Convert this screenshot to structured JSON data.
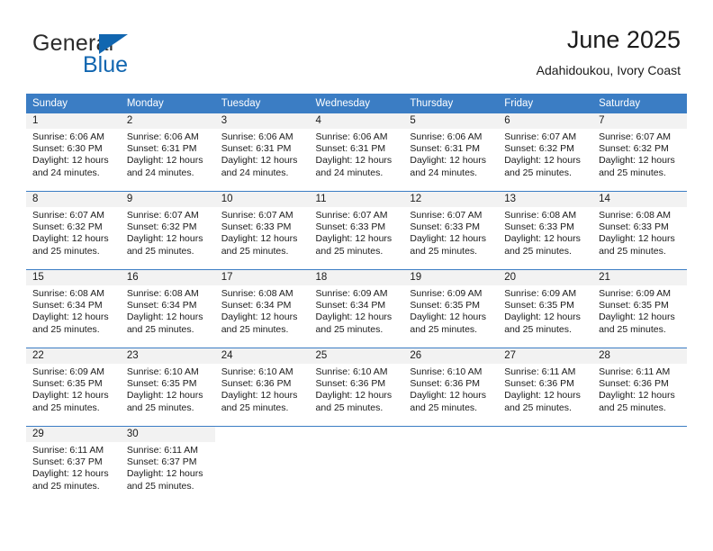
{
  "brand": {
    "line1": "General",
    "line2": "Blue",
    "accent_color": "#1166b0",
    "triangle_icon": "triangle-icon"
  },
  "header": {
    "title": "June 2025",
    "subtitle": "Adahidoukou, Ivory Coast"
  },
  "calendar": {
    "header_bg": "#3b7dc4",
    "header_text_color": "#ffffff",
    "daynum_bg": "#f2f2f2",
    "weekdays": [
      "Sunday",
      "Monday",
      "Tuesday",
      "Wednesday",
      "Thursday",
      "Friday",
      "Saturday"
    ],
    "weeks": [
      [
        {
          "day": "1",
          "sunrise": "Sunrise: 6:06 AM",
          "sunset": "Sunset: 6:30 PM",
          "daylight1": "Daylight: 12 hours",
          "daylight2": "and 24 minutes."
        },
        {
          "day": "2",
          "sunrise": "Sunrise: 6:06 AM",
          "sunset": "Sunset: 6:31 PM",
          "daylight1": "Daylight: 12 hours",
          "daylight2": "and 24 minutes."
        },
        {
          "day": "3",
          "sunrise": "Sunrise: 6:06 AM",
          "sunset": "Sunset: 6:31 PM",
          "daylight1": "Daylight: 12 hours",
          "daylight2": "and 24 minutes."
        },
        {
          "day": "4",
          "sunrise": "Sunrise: 6:06 AM",
          "sunset": "Sunset: 6:31 PM",
          "daylight1": "Daylight: 12 hours",
          "daylight2": "and 24 minutes."
        },
        {
          "day": "5",
          "sunrise": "Sunrise: 6:06 AM",
          "sunset": "Sunset: 6:31 PM",
          "daylight1": "Daylight: 12 hours",
          "daylight2": "and 24 minutes."
        },
        {
          "day": "6",
          "sunrise": "Sunrise: 6:07 AM",
          "sunset": "Sunset: 6:32 PM",
          "daylight1": "Daylight: 12 hours",
          "daylight2": "and 25 minutes."
        },
        {
          "day": "7",
          "sunrise": "Sunrise: 6:07 AM",
          "sunset": "Sunset: 6:32 PM",
          "daylight1": "Daylight: 12 hours",
          "daylight2": "and 25 minutes."
        }
      ],
      [
        {
          "day": "8",
          "sunrise": "Sunrise: 6:07 AM",
          "sunset": "Sunset: 6:32 PM",
          "daylight1": "Daylight: 12 hours",
          "daylight2": "and 25 minutes."
        },
        {
          "day": "9",
          "sunrise": "Sunrise: 6:07 AM",
          "sunset": "Sunset: 6:32 PM",
          "daylight1": "Daylight: 12 hours",
          "daylight2": "and 25 minutes."
        },
        {
          "day": "10",
          "sunrise": "Sunrise: 6:07 AM",
          "sunset": "Sunset: 6:33 PM",
          "daylight1": "Daylight: 12 hours",
          "daylight2": "and 25 minutes."
        },
        {
          "day": "11",
          "sunrise": "Sunrise: 6:07 AM",
          "sunset": "Sunset: 6:33 PM",
          "daylight1": "Daylight: 12 hours",
          "daylight2": "and 25 minutes."
        },
        {
          "day": "12",
          "sunrise": "Sunrise: 6:07 AM",
          "sunset": "Sunset: 6:33 PM",
          "daylight1": "Daylight: 12 hours",
          "daylight2": "and 25 minutes."
        },
        {
          "day": "13",
          "sunrise": "Sunrise: 6:08 AM",
          "sunset": "Sunset: 6:33 PM",
          "daylight1": "Daylight: 12 hours",
          "daylight2": "and 25 minutes."
        },
        {
          "day": "14",
          "sunrise": "Sunrise: 6:08 AM",
          "sunset": "Sunset: 6:33 PM",
          "daylight1": "Daylight: 12 hours",
          "daylight2": "and 25 minutes."
        }
      ],
      [
        {
          "day": "15",
          "sunrise": "Sunrise: 6:08 AM",
          "sunset": "Sunset: 6:34 PM",
          "daylight1": "Daylight: 12 hours",
          "daylight2": "and 25 minutes."
        },
        {
          "day": "16",
          "sunrise": "Sunrise: 6:08 AM",
          "sunset": "Sunset: 6:34 PM",
          "daylight1": "Daylight: 12 hours",
          "daylight2": "and 25 minutes."
        },
        {
          "day": "17",
          "sunrise": "Sunrise: 6:08 AM",
          "sunset": "Sunset: 6:34 PM",
          "daylight1": "Daylight: 12 hours",
          "daylight2": "and 25 minutes."
        },
        {
          "day": "18",
          "sunrise": "Sunrise: 6:09 AM",
          "sunset": "Sunset: 6:34 PM",
          "daylight1": "Daylight: 12 hours",
          "daylight2": "and 25 minutes."
        },
        {
          "day": "19",
          "sunrise": "Sunrise: 6:09 AM",
          "sunset": "Sunset: 6:35 PM",
          "daylight1": "Daylight: 12 hours",
          "daylight2": "and 25 minutes."
        },
        {
          "day": "20",
          "sunrise": "Sunrise: 6:09 AM",
          "sunset": "Sunset: 6:35 PM",
          "daylight1": "Daylight: 12 hours",
          "daylight2": "and 25 minutes."
        },
        {
          "day": "21",
          "sunrise": "Sunrise: 6:09 AM",
          "sunset": "Sunset: 6:35 PM",
          "daylight1": "Daylight: 12 hours",
          "daylight2": "and 25 minutes."
        }
      ],
      [
        {
          "day": "22",
          "sunrise": "Sunrise: 6:09 AM",
          "sunset": "Sunset: 6:35 PM",
          "daylight1": "Daylight: 12 hours",
          "daylight2": "and 25 minutes."
        },
        {
          "day": "23",
          "sunrise": "Sunrise: 6:10 AM",
          "sunset": "Sunset: 6:35 PM",
          "daylight1": "Daylight: 12 hours",
          "daylight2": "and 25 minutes."
        },
        {
          "day": "24",
          "sunrise": "Sunrise: 6:10 AM",
          "sunset": "Sunset: 6:36 PM",
          "daylight1": "Daylight: 12 hours",
          "daylight2": "and 25 minutes."
        },
        {
          "day": "25",
          "sunrise": "Sunrise: 6:10 AM",
          "sunset": "Sunset: 6:36 PM",
          "daylight1": "Daylight: 12 hours",
          "daylight2": "and 25 minutes."
        },
        {
          "day": "26",
          "sunrise": "Sunrise: 6:10 AM",
          "sunset": "Sunset: 6:36 PM",
          "daylight1": "Daylight: 12 hours",
          "daylight2": "and 25 minutes."
        },
        {
          "day": "27",
          "sunrise": "Sunrise: 6:11 AM",
          "sunset": "Sunset: 6:36 PM",
          "daylight1": "Daylight: 12 hours",
          "daylight2": "and 25 minutes."
        },
        {
          "day": "28",
          "sunrise": "Sunrise: 6:11 AM",
          "sunset": "Sunset: 6:36 PM",
          "daylight1": "Daylight: 12 hours",
          "daylight2": "and 25 minutes."
        }
      ],
      [
        {
          "day": "29",
          "sunrise": "Sunrise: 6:11 AM",
          "sunset": "Sunset: 6:37 PM",
          "daylight1": "Daylight: 12 hours",
          "daylight2": "and 25 minutes."
        },
        {
          "day": "30",
          "sunrise": "Sunrise: 6:11 AM",
          "sunset": "Sunset: 6:37 PM",
          "daylight1": "Daylight: 12 hours",
          "daylight2": "and 25 minutes."
        },
        {
          "day": "",
          "sunrise": "",
          "sunset": "",
          "daylight1": "",
          "daylight2": ""
        },
        {
          "day": "",
          "sunrise": "",
          "sunset": "",
          "daylight1": "",
          "daylight2": ""
        },
        {
          "day": "",
          "sunrise": "",
          "sunset": "",
          "daylight1": "",
          "daylight2": ""
        },
        {
          "day": "",
          "sunrise": "",
          "sunset": "",
          "daylight1": "",
          "daylight2": ""
        },
        {
          "day": "",
          "sunrise": "",
          "sunset": "",
          "daylight1": "",
          "daylight2": ""
        }
      ]
    ]
  }
}
